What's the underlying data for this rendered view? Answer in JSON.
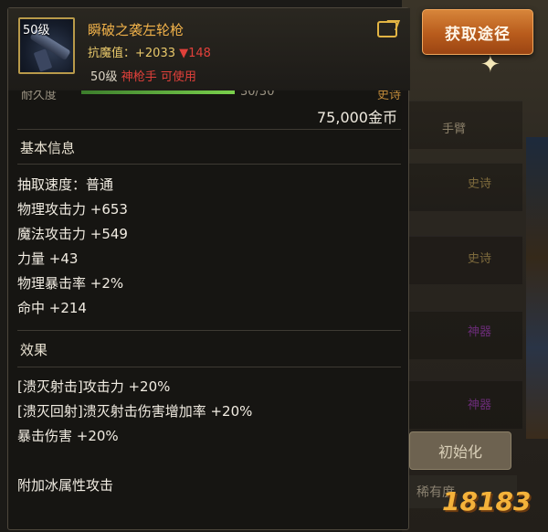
{
  "acquire_button": {
    "label": "获取途径"
  },
  "item": {
    "icon_level": "50级",
    "name": "瞬破之袭左轮枪",
    "resist_label": "抗魔值：",
    "resist_value": "+2033",
    "resist_diff": "▼148",
    "level_req": "50级",
    "class_req": "神枪手 可使用",
    "durability_label": "耐久度",
    "durability_value": "30/30",
    "durability_fraction": 1.0,
    "grade": "史诗",
    "price": "75,000金币"
  },
  "basic_info": {
    "title": "基本信息",
    "lines": [
      "抽取速度：普通",
      "物理攻击力 +653",
      "魔法攻击力 +549",
      "力量 +43",
      "物理暴击率 +2%",
      "命中 +214"
    ]
  },
  "effects": {
    "title": "效果",
    "lines": [
      "[溃灭射击]攻击力 +20%",
      "[溃灭回射]溃灭射击伤害增加率 +20%",
      "暴击伤害 +20%"
    ],
    "extra": "附加冰属性攻击"
  },
  "background": {
    "slot_label": "手臂",
    "grades": [
      "史诗",
      "史诗",
      "神器",
      "神器"
    ],
    "reset_button": "初始化",
    "rarity_label": "稀有度"
  },
  "watermark": {
    "text": "18183"
  },
  "colors": {
    "item_name": "#f1b24a",
    "resist": "#e8c86a",
    "downgrade": "#e0403a",
    "acquire_button": "#c0691f"
  }
}
